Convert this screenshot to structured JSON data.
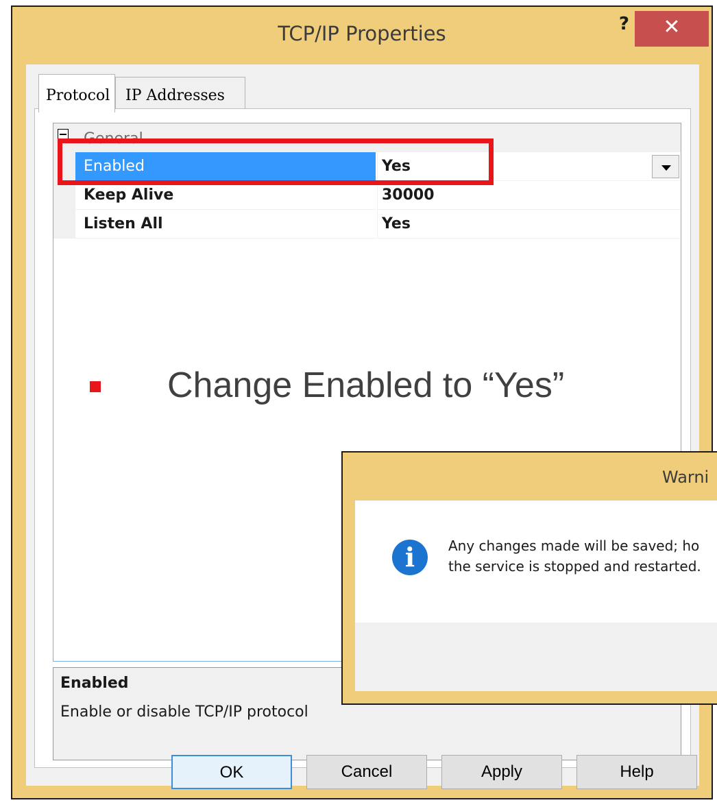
{
  "window": {
    "title": "TCP/IP Properties",
    "help_glyph": "?",
    "close_glyph": "✕"
  },
  "tabs": [
    {
      "label": "Protocol"
    },
    {
      "label": "IP Addresses"
    }
  ],
  "grid": {
    "category": "General",
    "rows": [
      {
        "name": "Enabled",
        "value": "Yes"
      },
      {
        "name": "Keep Alive",
        "value": "30000"
      },
      {
        "name": "Listen All",
        "value": "Yes"
      }
    ]
  },
  "description": {
    "title": "Enabled",
    "text": "Enable or disable TCP/IP protocol"
  },
  "buttons": {
    "ok": "OK",
    "cancel": "Cancel",
    "apply": "Apply",
    "help": "Help"
  },
  "annotation": {
    "bullet": "Change Enabled to “Yes”",
    "highlight_color": "#e8161b"
  },
  "warning": {
    "title": "Warni",
    "line1": "Any changes made will be saved; ho",
    "line2": "the service is stopped and restarted.",
    "icon": "i"
  },
  "colors": {
    "window_frame": "#f0cd7a",
    "selection": "#3399ff",
    "close_button": "#c7504f"
  }
}
